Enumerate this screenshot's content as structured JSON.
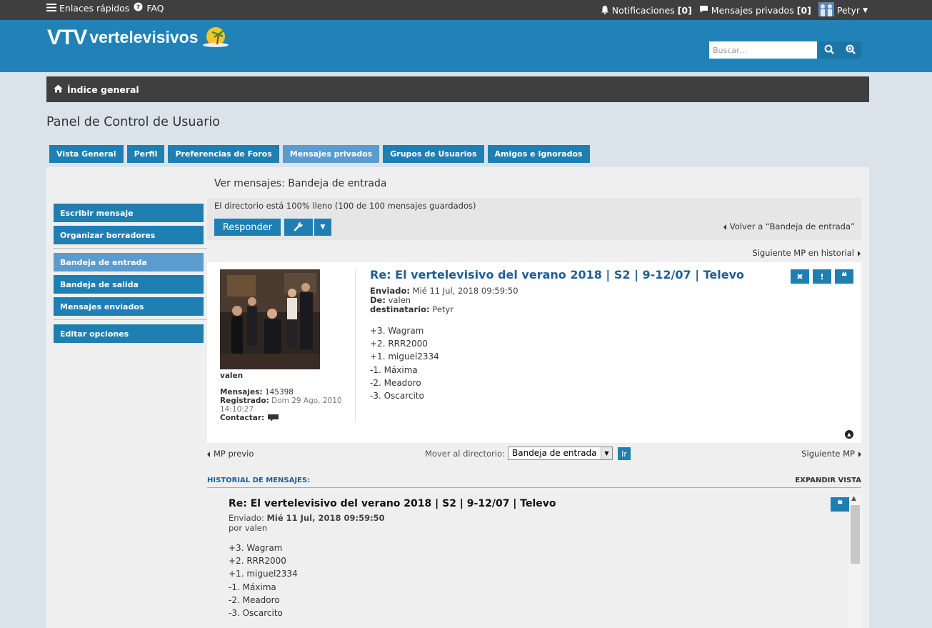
{
  "topbar": {
    "quick_links": "Enlaces rápidos",
    "faq": "FAQ",
    "notifications": "Notificaciones",
    "notifications_count": "[0]",
    "private_messages": "Mensajes privados",
    "pm_count": "[0]",
    "username": "Petyr"
  },
  "header": {
    "logo_mark": "VTV",
    "logo_text": "vertelevisivos",
    "search_placeholder": "Buscar…"
  },
  "breadcrumb": {
    "home": "Índice general"
  },
  "page_title": "Panel de Control de Usuario",
  "tabs": [
    {
      "label": "Vista General",
      "active": false
    },
    {
      "label": "Perfil",
      "active": false
    },
    {
      "label": "Preferencias de Foros",
      "active": false
    },
    {
      "label": "Mensajes privados",
      "active": true
    },
    {
      "label": "Grupos de Usuarios",
      "active": false
    },
    {
      "label": "Amigos e Ignorados",
      "active": false
    }
  ],
  "sidebar": {
    "items": [
      {
        "label": "Escribir mensaje"
      },
      {
        "label": "Organizar borradores"
      },
      {
        "label": "Bandeja de entrada",
        "active": true
      },
      {
        "label": "Bandeja de salida"
      },
      {
        "label": "Mensajes enviados"
      },
      {
        "label": "Editar opciones"
      }
    ]
  },
  "main": {
    "section_title": "Ver mensajes: Bandeja de entrada",
    "folder_status": "El directorio está 100% lleno (100 de 100 mensajes guardados)",
    "reply_label": "Responder",
    "back_link": "Volver a “Bandeja de entrada”",
    "next_history": "Siguiente MP en historial"
  },
  "message": {
    "title": "Re: El vertelevisivo del verano 2018 | S2 | 9-12/07 | Televo",
    "sent_label": "Enviado:",
    "sent_value": "Mié 11 Jul, 2018 09:59:50",
    "from_label": "De:",
    "from_value": "valen",
    "to_label": "destinatario:",
    "to_value": "Petyr",
    "body": [
      "+3. Wagram",
      "+2. RRR2000",
      "+1. miguel2334",
      "-1. Máxima",
      "-2. Meadoro",
      "-3. Oscarcito"
    ],
    "author": {
      "name": "valen",
      "posts_label": "Mensajes:",
      "posts_value": "145398",
      "registered_label": "Registrado:",
      "registered_value": "Dom 29 Ago, 2010 14:10:27",
      "contact_label": "Contactar:"
    }
  },
  "nav": {
    "prev": "MP previo",
    "move_label": "Mover al directorio:",
    "folder_selected": "Bandeja de entrada",
    "go": "Ir",
    "next": "Siguiente MP"
  },
  "history": {
    "header": "HISTORIAL DE MENSAJES:",
    "expand": "EXPANDIR VISTA",
    "title": "Re: El vertelevisivo del verano 2018 | S2 | 9-12/07 | Televo",
    "sent_label": "Enviado:",
    "sent_value": "Mié 11 Jul, 2018 09:59:50",
    "by": "por valen",
    "body": [
      "+3. Wagram",
      "+2. RRR2000",
      "+1. miguel2334",
      "-1. Máxima",
      "-2. Meadoro",
      "-3. Oscarcito"
    ]
  },
  "colors": {
    "accent": "#1f7fb3",
    "header_bg": "#2182b7",
    "topbar_bg": "#3f3f3f",
    "title_blue": "#1f5e97"
  }
}
